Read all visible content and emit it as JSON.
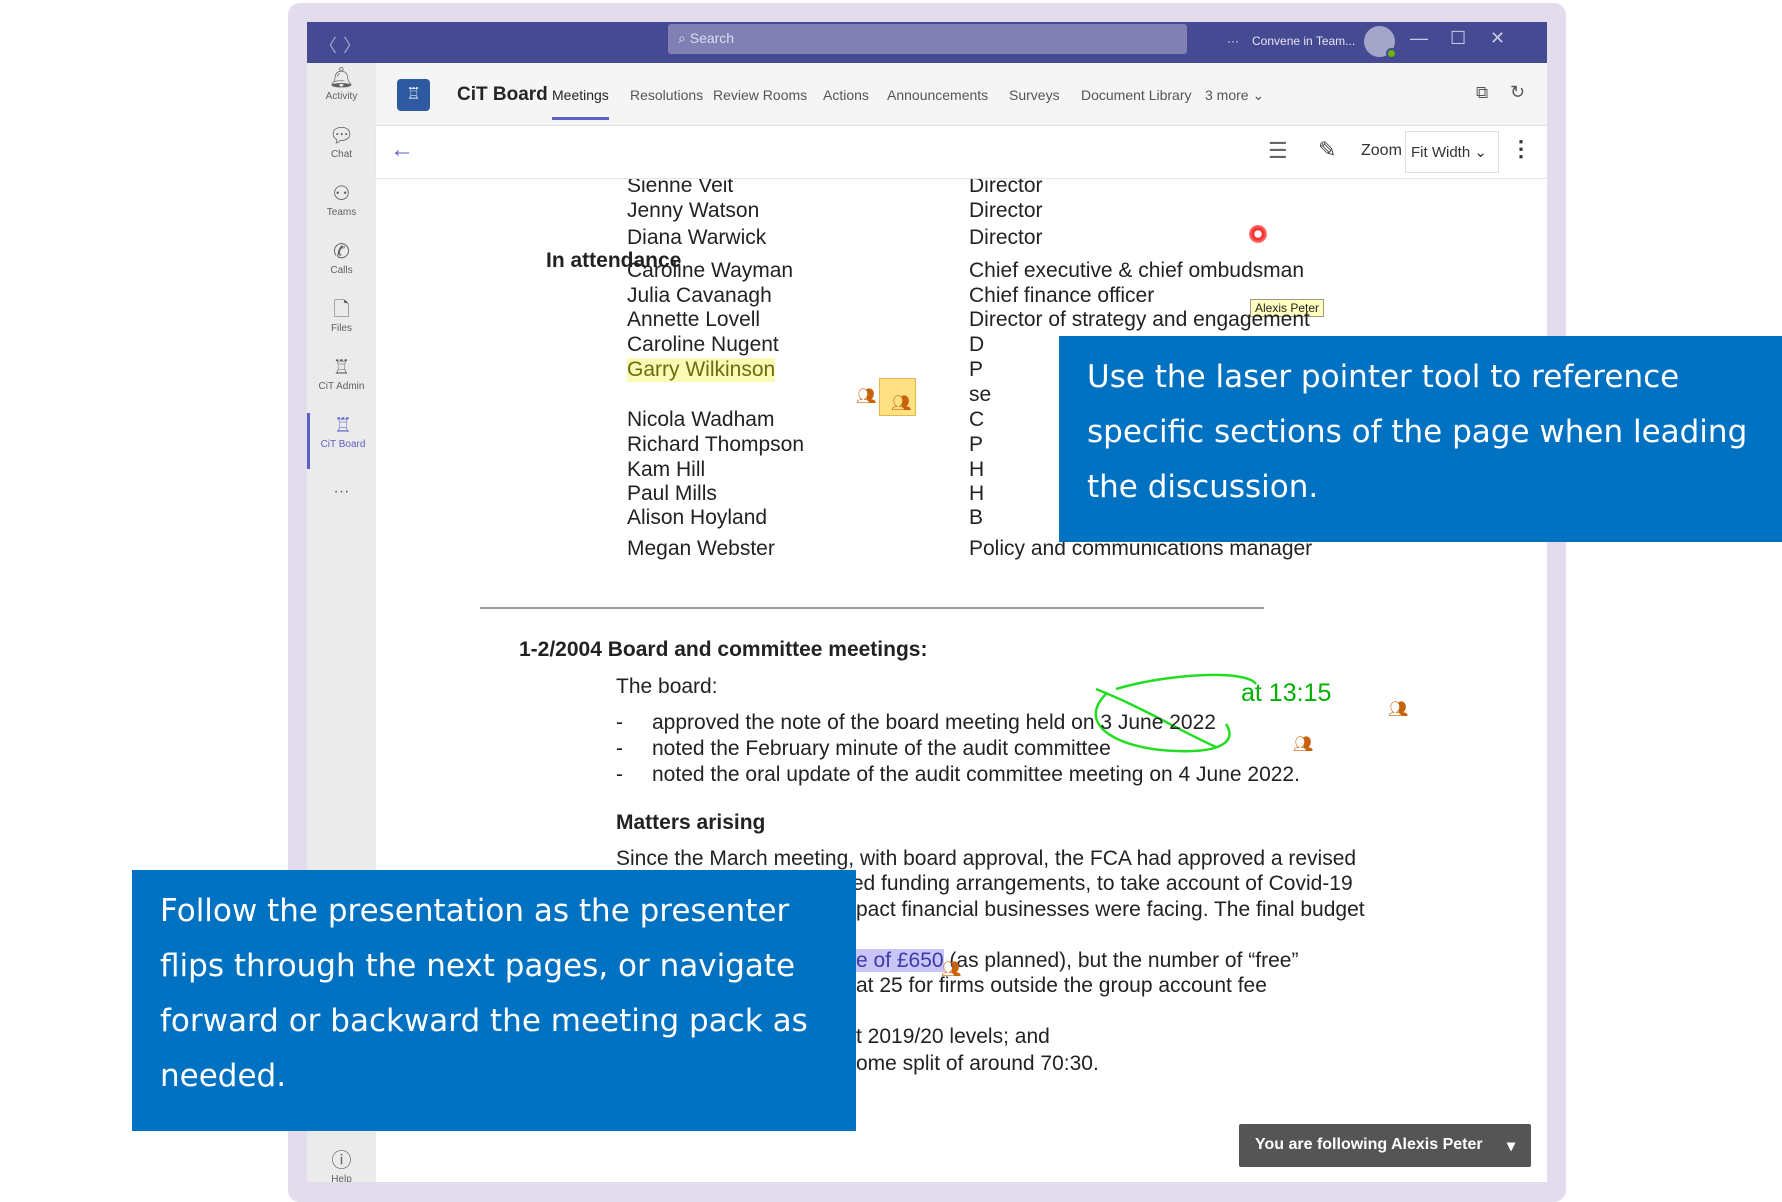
{
  "titlebar": {
    "search_placeholder": "Search",
    "more": "···",
    "account": "Convene in Team...",
    "back": "〈",
    "forward": "〉",
    "minimize": "—",
    "maximize": "☐",
    "close": "✕"
  },
  "sidebar": {
    "items": [
      {
        "label": "Activity",
        "icon": "bell-icon"
      },
      {
        "label": "Chat",
        "icon": "chat-icon"
      },
      {
        "label": "Teams",
        "icon": "teams-icon"
      },
      {
        "label": "Calls",
        "icon": "phone-icon"
      },
      {
        "label": "Files",
        "icon": "file-icon"
      },
      {
        "label": "CiT Admin",
        "icon": "cit-admin-icon"
      },
      {
        "label": "CiT Board",
        "icon": "cit-board-icon"
      }
    ],
    "more": "···",
    "help": "Help"
  },
  "app": {
    "title": "CiT Board",
    "tabs": [
      "Meetings",
      "Resolutions",
      "Review Rooms",
      "Actions",
      "Announcements",
      "Surveys",
      "Document Library",
      "3 more ⌄"
    ],
    "active_tab": "Meetings"
  },
  "toolbar": {
    "zoom_label": "Zoom",
    "zoom_value": "Fit Width"
  },
  "document": {
    "directors": [
      {
        "name": "Sienne Veit",
        "role": "Director"
      },
      {
        "name": "Jenny Watson",
        "role": "Director"
      },
      {
        "name": "Diana Warwick",
        "role": "Director"
      }
    ],
    "attendance_label": "In attendance",
    "attendance": [
      {
        "name": "Caroline Wayman",
        "role": "Chief executive & chief ombudsman"
      },
      {
        "name": "Julia Cavanagh",
        "role": "Chief finance officer"
      },
      {
        "name": "Annette Lovell",
        "role": "Director of strategy and engagement"
      },
      {
        "name": "Caroline Nugent",
        "role": "D"
      },
      {
        "name": "Garry Wilkinson",
        "role": "P"
      },
      {
        "name": "",
        "role": "se"
      },
      {
        "name": "Nicola Wadham",
        "role": "C"
      },
      {
        "name": "Richard Thompson",
        "role": "P"
      },
      {
        "name": "Kam Hill",
        "role": "H"
      },
      {
        "name": "Paul Mills",
        "role": "H"
      },
      {
        "name": "Alison Hoyland",
        "role": "B"
      },
      {
        "name": "Megan Webster",
        "role": "Policy and communications manager"
      }
    ],
    "section_heading": "1-2/2004 Board and committee meetings:",
    "board_intro": "The board:",
    "bullets": [
      "approved the note of the board meeting held on 3 June 2022",
      "noted the February minute of the audit committee",
      "noted the oral update of the audit committee meeting on 4 June 2022."
    ],
    "matters_heading": "Matters arising",
    "paragraph": [
      "Since the March meeting, with board approval, the FCA had approved a revised",
      "budget, alongside amended funding arrangements, to take account of Covid-19",
      "pact financial businesses were facing. The final budget"
    ],
    "fragments": {
      "highlight": "e of £650",
      "after_highlight": " (as planned), but the number of “free”",
      "line2": "at 25 for firms outside the group account fee",
      "line3": "t 2019/20 levels; and",
      "line4": "ome split of around 70:30."
    }
  },
  "annotations": {
    "ink_text": "at 13:15",
    "ink_color": "#00b000",
    "laser_user": "Alexis Peter",
    "laser_color": "#ff0000"
  },
  "follow_banner": "You are following Alexis Peter",
  "callouts": {
    "right": "Use the laser pointer tool to reference specific sections of the page when leading the discussion.",
    "left": "Follow the presentation as the presenter flips through the next pages, or navigate forward or backward the meeting pack as needed."
  },
  "colors": {
    "teams_purple": "#454a92",
    "accent": "#5b5fc7",
    "callout_blue": "#0171c2",
    "presence_orange": "#c9620d"
  }
}
